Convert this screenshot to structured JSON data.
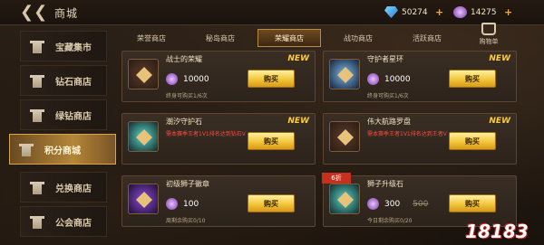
{
  "header": {
    "title": "商城",
    "currencies": [
      {
        "icon": "diamond-icon",
        "value": "50274"
      },
      {
        "icon": "token-icon",
        "value": "14275"
      }
    ],
    "plus": "+"
  },
  "sidebar": {
    "items": [
      {
        "label": "宝藏集市",
        "active": false
      },
      {
        "label": "钻石商店",
        "active": false
      },
      {
        "label": "绿钻商店",
        "active": false
      },
      {
        "label": "积分商城",
        "active": true
      },
      {
        "label": "兑换商店",
        "active": false
      },
      {
        "label": "公会商店",
        "active": false
      }
    ]
  },
  "tabs": [
    {
      "label": "荣誉商店",
      "active": false
    },
    {
      "label": "秘岛商店",
      "active": false
    },
    {
      "label": "荣耀商店",
      "active": true
    },
    {
      "label": "战功商店",
      "active": false
    },
    {
      "label": "活跃商店",
      "active": false
    }
  ],
  "cart": {
    "label": "购物单"
  },
  "cards": [
    {
      "name": "战士的荣耀",
      "badge": "NEW",
      "price": "10000",
      "limit": "终身可购买1/6次",
      "buy": "购买"
    },
    {
      "name": "守护者星环",
      "badge": "NEW",
      "price": "10000",
      "limit": "终身可购买1/6次",
      "buy": "购买"
    },
    {
      "name": "潮汐守护石",
      "badge": "NEW",
      "requirement": "需本赛季王者1V1排名达到钻石V",
      "buy": "购买"
    },
    {
      "name": "伟大航路罗盘",
      "badge": "NEW",
      "requirement": "需本赛季王者1V1排名达到王者V",
      "buy": "购买"
    },
    {
      "name": "初级狮子徽章",
      "price": "100",
      "limit": "周剩余购买0/10",
      "buy": "购买"
    },
    {
      "name": "狮子升级石",
      "discount": "6折",
      "price": "300",
      "old_price": "500",
      "limit": "今日剩余购买0/20",
      "buy": "购买"
    }
  ],
  "watermark": "18183"
}
